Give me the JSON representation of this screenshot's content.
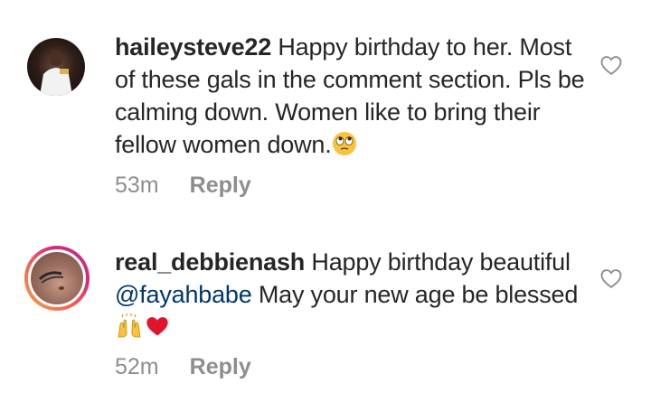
{
  "comments": [
    {
      "username": "haileysteve22",
      "text": "Happy birthday to her. Most of these gals in the comment section. Pls be calming down. Women like to bring their fellow women down.",
      "emoji": "face-with-rolling-eyes-emoji",
      "time": "53m",
      "reply_label": "Reply",
      "like_icon": "heart-outline-icon"
    },
    {
      "username": "real_debbienash",
      "text_before": "Happy birthday beautiful",
      "mention": "@fayahbabe",
      "text_after": "May your new age be blessed",
      "emojis": [
        "raising-hands-emoji",
        "red-heart-emoji"
      ],
      "time": "52m",
      "reply_label": "Reply",
      "like_icon": "heart-outline-icon"
    }
  ],
  "colors": {
    "text": "#262626",
    "meta": "#8e8e8e",
    "mention": "#00376b",
    "heart_emoji": "#e0152b",
    "story_ring": "#d62976"
  }
}
